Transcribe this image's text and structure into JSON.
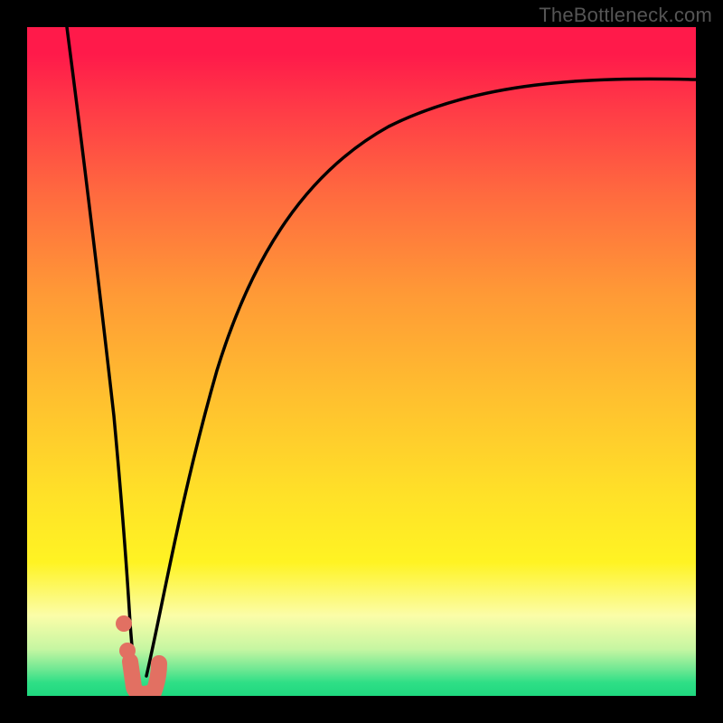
{
  "watermark": "TheBottleneck.com",
  "chart_data": {
    "type": "line",
    "title": "",
    "xlabel": "",
    "ylabel": "",
    "x_range": [
      0,
      100
    ],
    "y_range": [
      0,
      100
    ],
    "series": [
      {
        "name": "left-branch",
        "x": [
          6,
          8,
          10,
          12,
          14,
          15,
          16
        ],
        "y": [
          100,
          82,
          64,
          46,
          28,
          14,
          4
        ]
      },
      {
        "name": "right-branch",
        "x": [
          18,
          20,
          22,
          25,
          30,
          35,
          40,
          50,
          60,
          70,
          80,
          90,
          100
        ],
        "y": [
          8,
          20,
          32,
          47,
          62,
          71,
          77,
          84,
          87,
          89,
          90.5,
          91.5,
          92
        ]
      }
    ],
    "markers": {
      "name": "bottleneck-points",
      "kind": "filled-rounded",
      "color": "#e27062",
      "points": [
        {
          "x": 14.2,
          "y": 11
        },
        {
          "x": 14.8,
          "y": 7
        }
      ],
      "segment": {
        "x0": 15.2,
        "y0": 3.5,
        "x1": 18.2,
        "y1": 3.0
      }
    },
    "gradient_stops": [
      {
        "pos": 0.0,
        "color": "#ff1a4a"
      },
      {
        "pos": 0.5,
        "color": "#ffbf2f"
      },
      {
        "pos": 0.8,
        "color": "#fff323"
      },
      {
        "pos": 1.0,
        "color": "#1fd77f"
      }
    ]
  }
}
